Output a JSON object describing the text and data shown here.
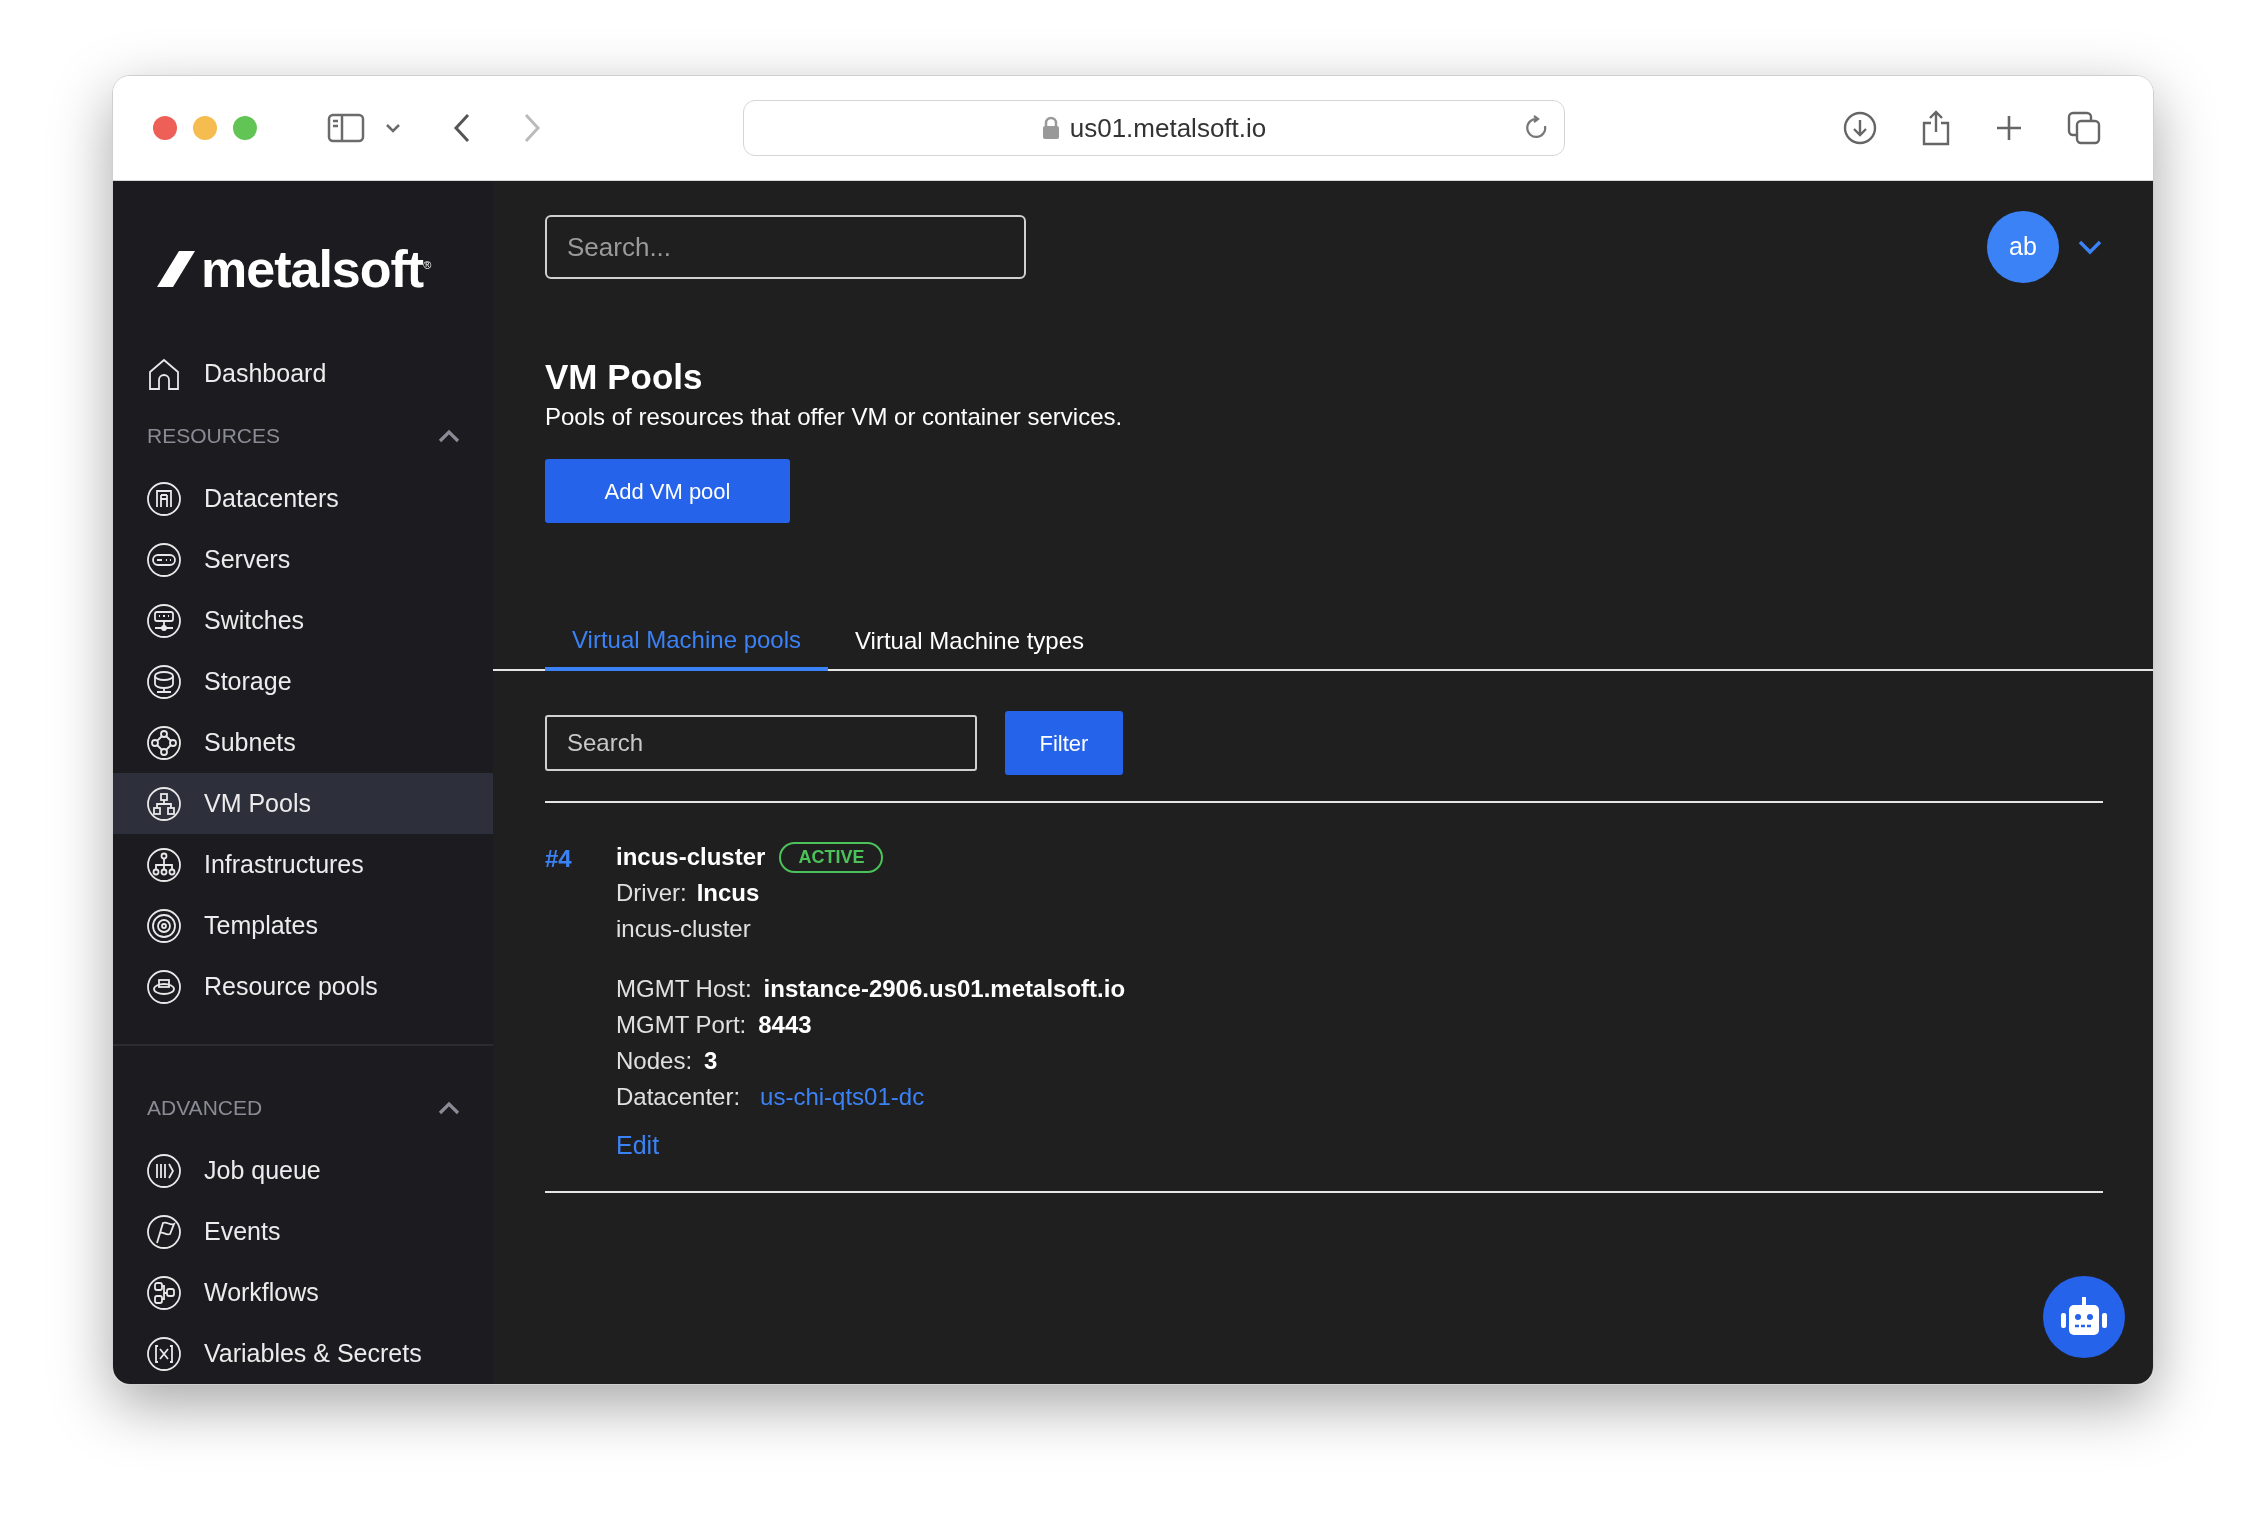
{
  "browser": {
    "url": "us01.metalsoft.io"
  },
  "sidebar": {
    "logo": {
      "text": "metalsoft",
      "mark": "®"
    },
    "home": {
      "label": "Dashboard",
      "selected": false
    },
    "groups": [
      {
        "title": "RESOURCES",
        "expanded": true,
        "items": [
          {
            "label": "Datacenters",
            "selected": false
          },
          {
            "label": "Servers",
            "selected": false
          },
          {
            "label": "Switches",
            "selected": false
          },
          {
            "label": "Storage",
            "selected": false
          },
          {
            "label": "Subnets",
            "selected": false
          },
          {
            "label": "VM Pools",
            "selected": true
          },
          {
            "label": "Infrastructures",
            "selected": false
          },
          {
            "label": "Templates",
            "selected": false
          },
          {
            "label": "Resource pools",
            "selected": false
          }
        ]
      },
      {
        "title": "ADVANCED",
        "expanded": true,
        "items": [
          {
            "label": "Job queue",
            "selected": false
          },
          {
            "label": "Events",
            "selected": false
          },
          {
            "label": "Workflows",
            "selected": false
          },
          {
            "label": "Variables & Secrets",
            "selected": false
          }
        ]
      }
    ]
  },
  "header": {
    "search": {
      "placeholder": "Search..."
    },
    "avatar": "ab"
  },
  "page": {
    "title": "VM Pools",
    "subtitle": "Pools of resources that offer VM or container services.",
    "add_button": "Add VM pool"
  },
  "tabs": [
    {
      "label": "Virtual Machine pools",
      "selected": true
    },
    {
      "label": "Virtual Machine types",
      "selected": false
    }
  ],
  "filter": {
    "search": {
      "placeholder": "Search"
    },
    "button": "Filter"
  },
  "pools": [
    {
      "id": "#4",
      "name": "incus-cluster",
      "status": "ACTIVE",
      "color": "#4cc35a",
      "driver_label": "Driver:",
      "driver": "Incus",
      "description": "incus-cluster",
      "fields": [
        {
          "label": "MGMT Host:",
          "value": "instance-2906.us01.metalsoft.io",
          "kind": "text"
        },
        {
          "label": "MGMT Port:",
          "value": "8443",
          "kind": "text"
        },
        {
          "label": "Nodes:",
          "value": "3",
          "kind": "text"
        },
        {
          "label": "Datacenter:",
          "value": "us-chi-qts01-dc",
          "kind": "link"
        }
      ],
      "edit": "Edit"
    }
  ]
}
